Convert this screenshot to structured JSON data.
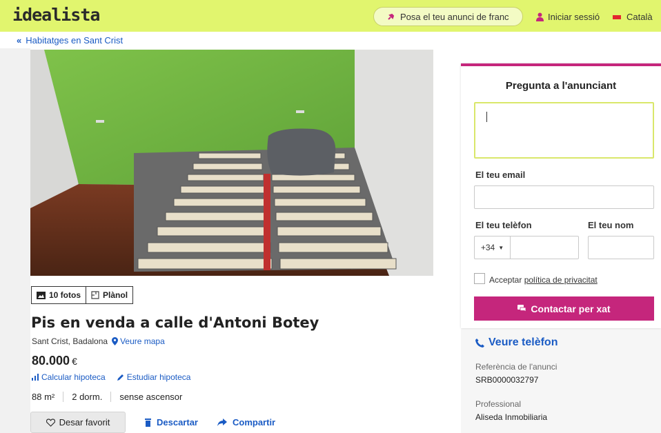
{
  "header": {
    "logo": "idealista",
    "publish_label": "Posa el teu anunci de franc",
    "login_label": "Iniciar sessió",
    "language_label": "Català",
    "colors": {
      "header_bg": "#e1f56e",
      "accent": "#c5267c",
      "link": "#1a5bc4"
    }
  },
  "breadcrumb": {
    "back_label": "Habitatges en Sant Crist"
  },
  "gallery": {
    "photos_label": "10 fotos",
    "plan_label": "Plànol"
  },
  "listing": {
    "title": "Pis en venda a calle d'Antoni Botey",
    "location": "Sant Crist, Badalona",
    "map_label": "Veure mapa",
    "price": "80.000",
    "currency": "€",
    "calc_mortgage": "Calcular hipoteca",
    "study_mortgage": "Estudiar hipoteca",
    "features": [
      "88 m²",
      "2 dorm.",
      "sense ascensor"
    ],
    "save_label": "Desar favorit",
    "discard_label": "Descartar",
    "share_label": "Compartir"
  },
  "contact": {
    "title": "Pregunta a l'anunciant",
    "message_value": "",
    "email_label": "El teu email",
    "phone_label": "El teu telèfon",
    "name_label": "El teu nom",
    "prefix": "+34",
    "privacy_prefix": "Acceptar ",
    "privacy_link": "política de privacitat",
    "chat_label": "Contactar per xat",
    "see_phone_label": "Veure telèfon",
    "ref_label": "Referència de l'anunci",
    "ref_value": "SRB0000032797",
    "pro_label": "Professional",
    "pro_value": "Aliseda Inmobiliaria"
  }
}
